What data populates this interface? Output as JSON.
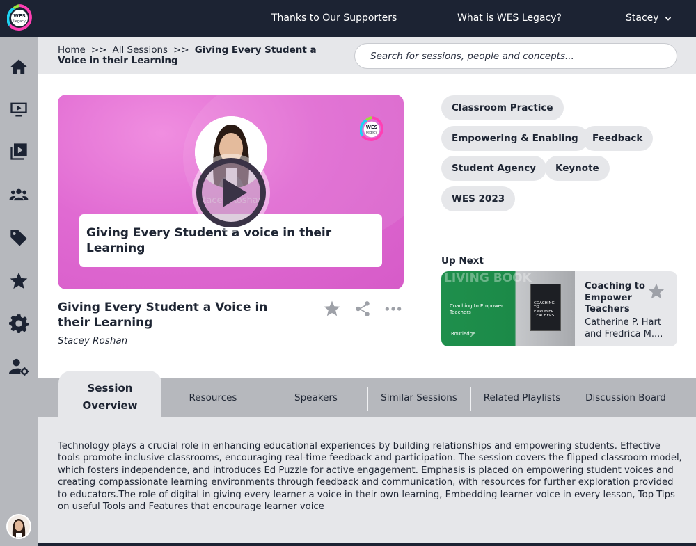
{
  "app": {
    "logo_text": "WES Legacy"
  },
  "topnav": {
    "supporters": "Thanks to Our Supporters",
    "about": "What is WES Legacy?",
    "user": "Stacey"
  },
  "breadcrumb": {
    "home": "Home",
    "sep": ">>",
    "sessions": "All Sessions",
    "current": "Giving Every Student a Voice in their Learning"
  },
  "search": {
    "placeholder": "Search for sessions, people and concepts..."
  },
  "video": {
    "caption": "Giving Every Student a voice in their Learning",
    "ghost_name": "Stacey Roshan"
  },
  "session": {
    "title": "Giving Every Student a Voice in their Learning",
    "speaker": "Stacey Roshan"
  },
  "tags": [
    "Classroom Practice",
    "Empowering & Enabling",
    "Feedback",
    "Student Agency",
    "Keynote",
    "WES 2023"
  ],
  "up_next": {
    "label": "Up Next",
    "title": "Coaching to Empower Teachers",
    "authors": "Catherine P. Hart and Fredrica M....",
    "thumb_big": "LIVING BOOK",
    "thumb_small": "Coaching to Empower Teachers",
    "thumb_publisher": "Routledge",
    "book_title": "COACHING TO EMPOWER TEACHERS"
  },
  "tabs": [
    "Session Overview",
    "Resources",
    "Speakers",
    "Similar Sessions",
    "Related Playlists",
    "Discussion Board"
  ],
  "description": "Technology plays a crucial role in enhancing educational experiences by building relationships and empowering students. Effective tools promote inclusive classrooms, encouraging real-time feedback and participation. The session covers the flipped classroom model, which fosters independence, and introduces Ed Puzzle for active engagement. Emphasis is placed on empowering student voices and creating compassionate learning environments through feedback and communication, with resources for further exploration provided to educators.The role of digital in giving every learner a voice in their own learning, Embedding learner voice in every lesson, Top Tips on useful Tools and Features that encourage learner voice",
  "colors": {
    "navy": "#1c2333",
    "sidebar": "#b6b8bd",
    "band": "#e6e7ea",
    "video_pink": "#e06ad2",
    "icon_grey": "#9ea1a8"
  }
}
